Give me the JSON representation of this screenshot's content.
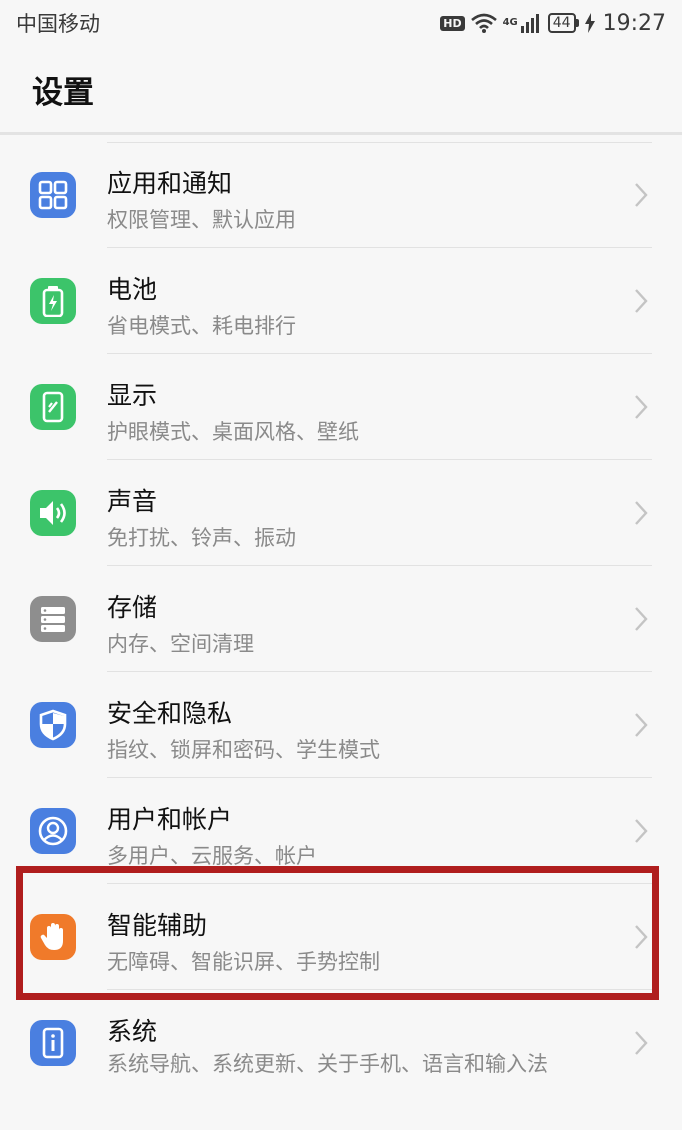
{
  "status_bar": {
    "carrier": "中国移动",
    "hd": "HD",
    "network": "4G",
    "battery": "44",
    "time": "19:27"
  },
  "header": {
    "title": "设置"
  },
  "settings": [
    {
      "title": "应用和通知",
      "subtitle": "权限管理、默认应用",
      "icon": "apps-grid-icon",
      "color": "#4a7fe0"
    },
    {
      "title": "电池",
      "subtitle": "省电模式、耗电排行",
      "icon": "battery-icon",
      "color": "#3cc46a"
    },
    {
      "title": "显示",
      "subtitle": "护眼模式、桌面风格、壁纸",
      "icon": "display-icon",
      "color": "#3cc46a"
    },
    {
      "title": "声音",
      "subtitle": "免打扰、铃声、振动",
      "icon": "speaker-icon",
      "color": "#3cc46a"
    },
    {
      "title": "存储",
      "subtitle": "内存、空间清理",
      "icon": "storage-icon",
      "color": "#8e8e8e"
    },
    {
      "title": "安全和隐私",
      "subtitle": "指纹、锁屏和密码、学生模式",
      "icon": "shield-icon",
      "color": "#4a7fe0"
    },
    {
      "title": "用户和帐户",
      "subtitle": "多用户、云服务、帐户",
      "icon": "user-icon",
      "color": "#4a7fe0"
    },
    {
      "title": "智能辅助",
      "subtitle": "无障碍、智能识屏、手势控制",
      "icon": "hand-icon",
      "color": "#f07a2a"
    },
    {
      "title": "系统",
      "subtitle": "系统导航、系统更新、关于手机、语言和输入法",
      "icon": "system-info-icon",
      "color": "#4a7fe0"
    }
  ],
  "highlight_color": "#b01e1e"
}
